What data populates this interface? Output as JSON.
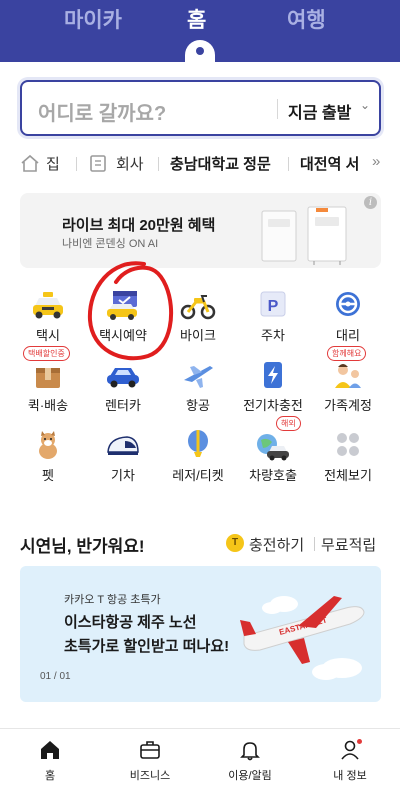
{
  "top_tabs": {
    "mycar": "마이카",
    "home": "홈",
    "travel": "여행"
  },
  "search": {
    "placeholder": "어디로 갈까요?",
    "depart_label": "지금 출발",
    "chevron": "⌄"
  },
  "quick_destinations": {
    "home": "집",
    "work": "회사",
    "place1": "충남대학교 정문",
    "place2": "대전역 서",
    "more": "»"
  },
  "ad": {
    "title": "라이브 최대 20만원 혜택",
    "subtitle": "나비엔 콘덴싱 ON AI",
    "info": "i"
  },
  "services": [
    {
      "label": "택시",
      "icon": "taxi-icon"
    },
    {
      "label": "택시예약",
      "icon": "taxi-reservation-icon"
    },
    {
      "label": "바이크",
      "icon": "bike-icon"
    },
    {
      "label": "주차",
      "icon": "parking-icon"
    },
    {
      "label": "대리",
      "icon": "designated-driver-icon"
    },
    {
      "label": "퀵·배송",
      "icon": "delivery-icon",
      "badge": "택배할인중"
    },
    {
      "label": "렌터카",
      "icon": "rental-car-icon"
    },
    {
      "label": "항공",
      "icon": "airplane-icon"
    },
    {
      "label": "전기차충전",
      "icon": "ev-charge-icon"
    },
    {
      "label": "가족계정",
      "icon": "family-account-icon",
      "badge": "함께해요"
    },
    {
      "label": "펫",
      "icon": "pet-icon"
    },
    {
      "label": "기차",
      "icon": "train-icon"
    },
    {
      "label": "레저/티켓",
      "icon": "leisure-ticket-icon"
    },
    {
      "label": "차량호출",
      "icon": "car-call-icon",
      "badge": "해외"
    },
    {
      "label": "전체보기",
      "icon": "view-all-icon"
    }
  ],
  "greeting": {
    "text": "시연님, 반가워요!",
    "coin": "T",
    "charge": "충전하기",
    "free": "무료적립"
  },
  "promo": {
    "eyebrow": "카카오 T 항공 초특가",
    "line1": "이스타항공 제주 노선",
    "line2": "초특가로 할인받고 떠나요!",
    "page": "01 / 01",
    "plane_text": "EASTAR JET"
  },
  "bottom_nav": {
    "home": "홈",
    "business": "비즈니스",
    "usage": "이용/알림",
    "my": "내 정보"
  },
  "colors": {
    "brand": "#3a43a0",
    "accent_red": "#e23a3a",
    "promo_bg": "#dff0fb"
  }
}
